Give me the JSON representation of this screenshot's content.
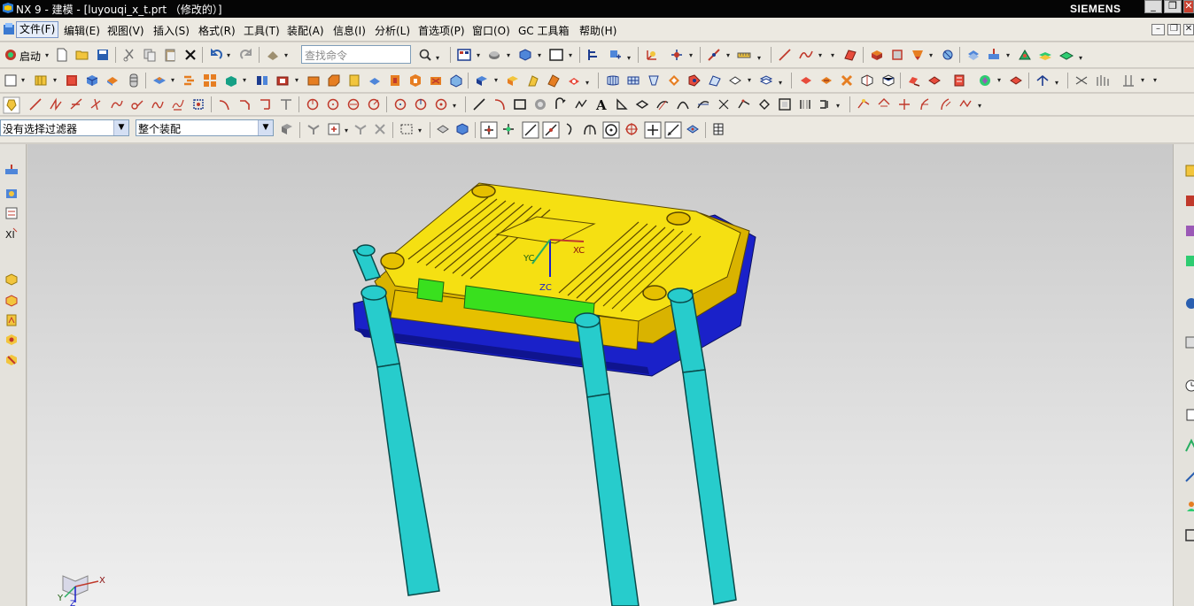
{
  "window": {
    "title": "NX 9 - 建模 - [luyouqi_x_t.prt （修改的）]",
    "brand": "SIEMENS",
    "minimize": "_",
    "restore": "❐",
    "close": "✕"
  },
  "menu": {
    "items": [
      "文件(F)",
      "编辑(E)",
      "视图(V)",
      "插入(S)",
      "格式(R)",
      "工具(T)",
      "装配(A)",
      "信息(I)",
      "分析(L)",
      "首选项(P)",
      "窗口(O)",
      "GC 工具箱",
      "帮助(H)"
    ]
  },
  "toolbar": {
    "start_label": "启动",
    "search_placeholder": "查找命令"
  },
  "selection_bar": {
    "filter_value": "没有选择过滤器",
    "scope_value": "整个装配"
  },
  "viewport": {
    "wcs_labels": {
      "xc": "XC",
      "yc": "YC",
      "zc": "ZC"
    },
    "triad_labels": {
      "x": "X",
      "y": "Y",
      "z": "Z"
    }
  },
  "colors": {
    "housing_top": "#f5e012",
    "housing_shade": "#d9b300",
    "base_plate": "#1a21c9",
    "green_panel": "#39e01e",
    "antenna": "#27cccc",
    "title_bg": "#050505",
    "toolbar_bg": "#ece9e1"
  }
}
